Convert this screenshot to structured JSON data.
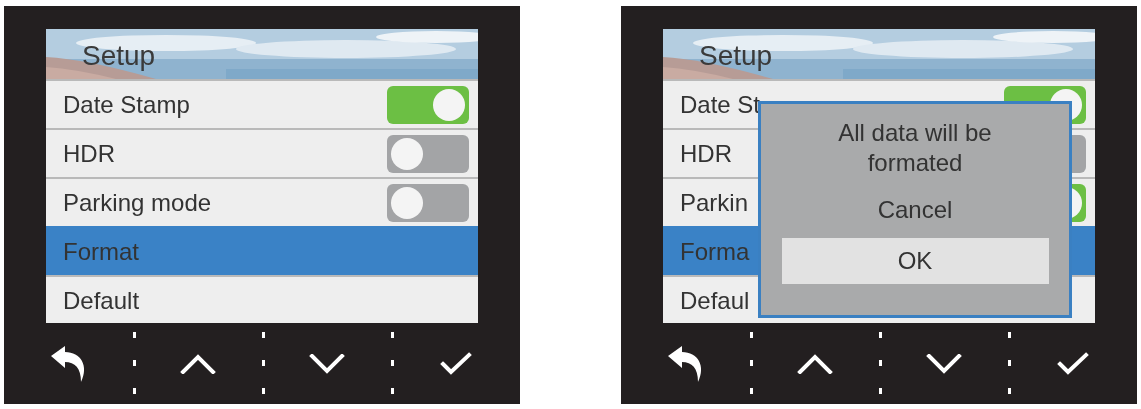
{
  "screens": [
    {
      "title": "Setup",
      "items": [
        {
          "label": "Date Stamp",
          "kind": "toggle",
          "on": true,
          "selected": false
        },
        {
          "label": "HDR",
          "kind": "toggle",
          "on": false,
          "selected": false
        },
        {
          "label": "Parking mode",
          "kind": "toggle",
          "on": false,
          "selected": false
        },
        {
          "label": "Format",
          "kind": "action",
          "selected": true
        },
        {
          "label": "Default",
          "kind": "action",
          "selected": false
        }
      ]
    },
    {
      "title": "Setup",
      "items": [
        {
          "label": "Date St",
          "kind": "toggle",
          "on": true,
          "selected": false
        },
        {
          "label": "HDR",
          "kind": "toggle",
          "on": false,
          "selected": false
        },
        {
          "label": "Parkin",
          "kind": "toggle",
          "on": true,
          "selected": false
        },
        {
          "label": "Forma",
          "kind": "action",
          "selected": true
        },
        {
          "label": "Defaul",
          "kind": "action",
          "selected": false
        }
      ],
      "dialog": {
        "message": "All data will be formated",
        "buttons": [
          {
            "label": "Cancel",
            "selected": false
          },
          {
            "label": "OK",
            "selected": true
          }
        ]
      }
    }
  ]
}
